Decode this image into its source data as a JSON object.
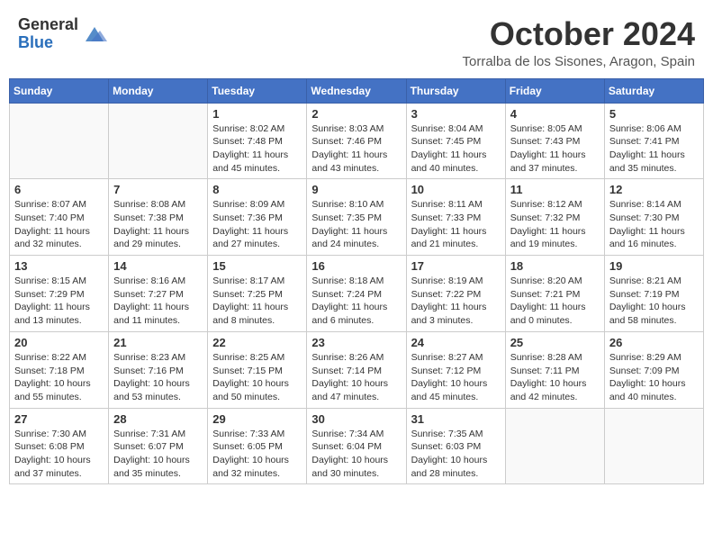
{
  "header": {
    "logo_line1": "General",
    "logo_line2": "Blue",
    "month_title": "October 2024",
    "location": "Torralba de los Sisones, Aragon, Spain"
  },
  "days_of_week": [
    "Sunday",
    "Monday",
    "Tuesday",
    "Wednesday",
    "Thursday",
    "Friday",
    "Saturday"
  ],
  "weeks": [
    [
      {
        "day": "",
        "info": ""
      },
      {
        "day": "",
        "info": ""
      },
      {
        "day": "1",
        "info": "Sunrise: 8:02 AM\nSunset: 7:48 PM\nDaylight: 11 hours and 45 minutes."
      },
      {
        "day": "2",
        "info": "Sunrise: 8:03 AM\nSunset: 7:46 PM\nDaylight: 11 hours and 43 minutes."
      },
      {
        "day": "3",
        "info": "Sunrise: 8:04 AM\nSunset: 7:45 PM\nDaylight: 11 hours and 40 minutes."
      },
      {
        "day": "4",
        "info": "Sunrise: 8:05 AM\nSunset: 7:43 PM\nDaylight: 11 hours and 37 minutes."
      },
      {
        "day": "5",
        "info": "Sunrise: 8:06 AM\nSunset: 7:41 PM\nDaylight: 11 hours and 35 minutes."
      }
    ],
    [
      {
        "day": "6",
        "info": "Sunrise: 8:07 AM\nSunset: 7:40 PM\nDaylight: 11 hours and 32 minutes."
      },
      {
        "day": "7",
        "info": "Sunrise: 8:08 AM\nSunset: 7:38 PM\nDaylight: 11 hours and 29 minutes."
      },
      {
        "day": "8",
        "info": "Sunrise: 8:09 AM\nSunset: 7:36 PM\nDaylight: 11 hours and 27 minutes."
      },
      {
        "day": "9",
        "info": "Sunrise: 8:10 AM\nSunset: 7:35 PM\nDaylight: 11 hours and 24 minutes."
      },
      {
        "day": "10",
        "info": "Sunrise: 8:11 AM\nSunset: 7:33 PM\nDaylight: 11 hours and 21 minutes."
      },
      {
        "day": "11",
        "info": "Sunrise: 8:12 AM\nSunset: 7:32 PM\nDaylight: 11 hours and 19 minutes."
      },
      {
        "day": "12",
        "info": "Sunrise: 8:14 AM\nSunset: 7:30 PM\nDaylight: 11 hours and 16 minutes."
      }
    ],
    [
      {
        "day": "13",
        "info": "Sunrise: 8:15 AM\nSunset: 7:29 PM\nDaylight: 11 hours and 13 minutes."
      },
      {
        "day": "14",
        "info": "Sunrise: 8:16 AM\nSunset: 7:27 PM\nDaylight: 11 hours and 11 minutes."
      },
      {
        "day": "15",
        "info": "Sunrise: 8:17 AM\nSunset: 7:25 PM\nDaylight: 11 hours and 8 minutes."
      },
      {
        "day": "16",
        "info": "Sunrise: 8:18 AM\nSunset: 7:24 PM\nDaylight: 11 hours and 6 minutes."
      },
      {
        "day": "17",
        "info": "Sunrise: 8:19 AM\nSunset: 7:22 PM\nDaylight: 11 hours and 3 minutes."
      },
      {
        "day": "18",
        "info": "Sunrise: 8:20 AM\nSunset: 7:21 PM\nDaylight: 11 hours and 0 minutes."
      },
      {
        "day": "19",
        "info": "Sunrise: 8:21 AM\nSunset: 7:19 PM\nDaylight: 10 hours and 58 minutes."
      }
    ],
    [
      {
        "day": "20",
        "info": "Sunrise: 8:22 AM\nSunset: 7:18 PM\nDaylight: 10 hours and 55 minutes."
      },
      {
        "day": "21",
        "info": "Sunrise: 8:23 AM\nSunset: 7:16 PM\nDaylight: 10 hours and 53 minutes."
      },
      {
        "day": "22",
        "info": "Sunrise: 8:25 AM\nSunset: 7:15 PM\nDaylight: 10 hours and 50 minutes."
      },
      {
        "day": "23",
        "info": "Sunrise: 8:26 AM\nSunset: 7:14 PM\nDaylight: 10 hours and 47 minutes."
      },
      {
        "day": "24",
        "info": "Sunrise: 8:27 AM\nSunset: 7:12 PM\nDaylight: 10 hours and 45 minutes."
      },
      {
        "day": "25",
        "info": "Sunrise: 8:28 AM\nSunset: 7:11 PM\nDaylight: 10 hours and 42 minutes."
      },
      {
        "day": "26",
        "info": "Sunrise: 8:29 AM\nSunset: 7:09 PM\nDaylight: 10 hours and 40 minutes."
      }
    ],
    [
      {
        "day": "27",
        "info": "Sunrise: 7:30 AM\nSunset: 6:08 PM\nDaylight: 10 hours and 37 minutes."
      },
      {
        "day": "28",
        "info": "Sunrise: 7:31 AM\nSunset: 6:07 PM\nDaylight: 10 hours and 35 minutes."
      },
      {
        "day": "29",
        "info": "Sunrise: 7:33 AM\nSunset: 6:05 PM\nDaylight: 10 hours and 32 minutes."
      },
      {
        "day": "30",
        "info": "Sunrise: 7:34 AM\nSunset: 6:04 PM\nDaylight: 10 hours and 30 minutes."
      },
      {
        "day": "31",
        "info": "Sunrise: 7:35 AM\nSunset: 6:03 PM\nDaylight: 10 hours and 28 minutes."
      },
      {
        "day": "",
        "info": ""
      },
      {
        "day": "",
        "info": ""
      }
    ]
  ]
}
